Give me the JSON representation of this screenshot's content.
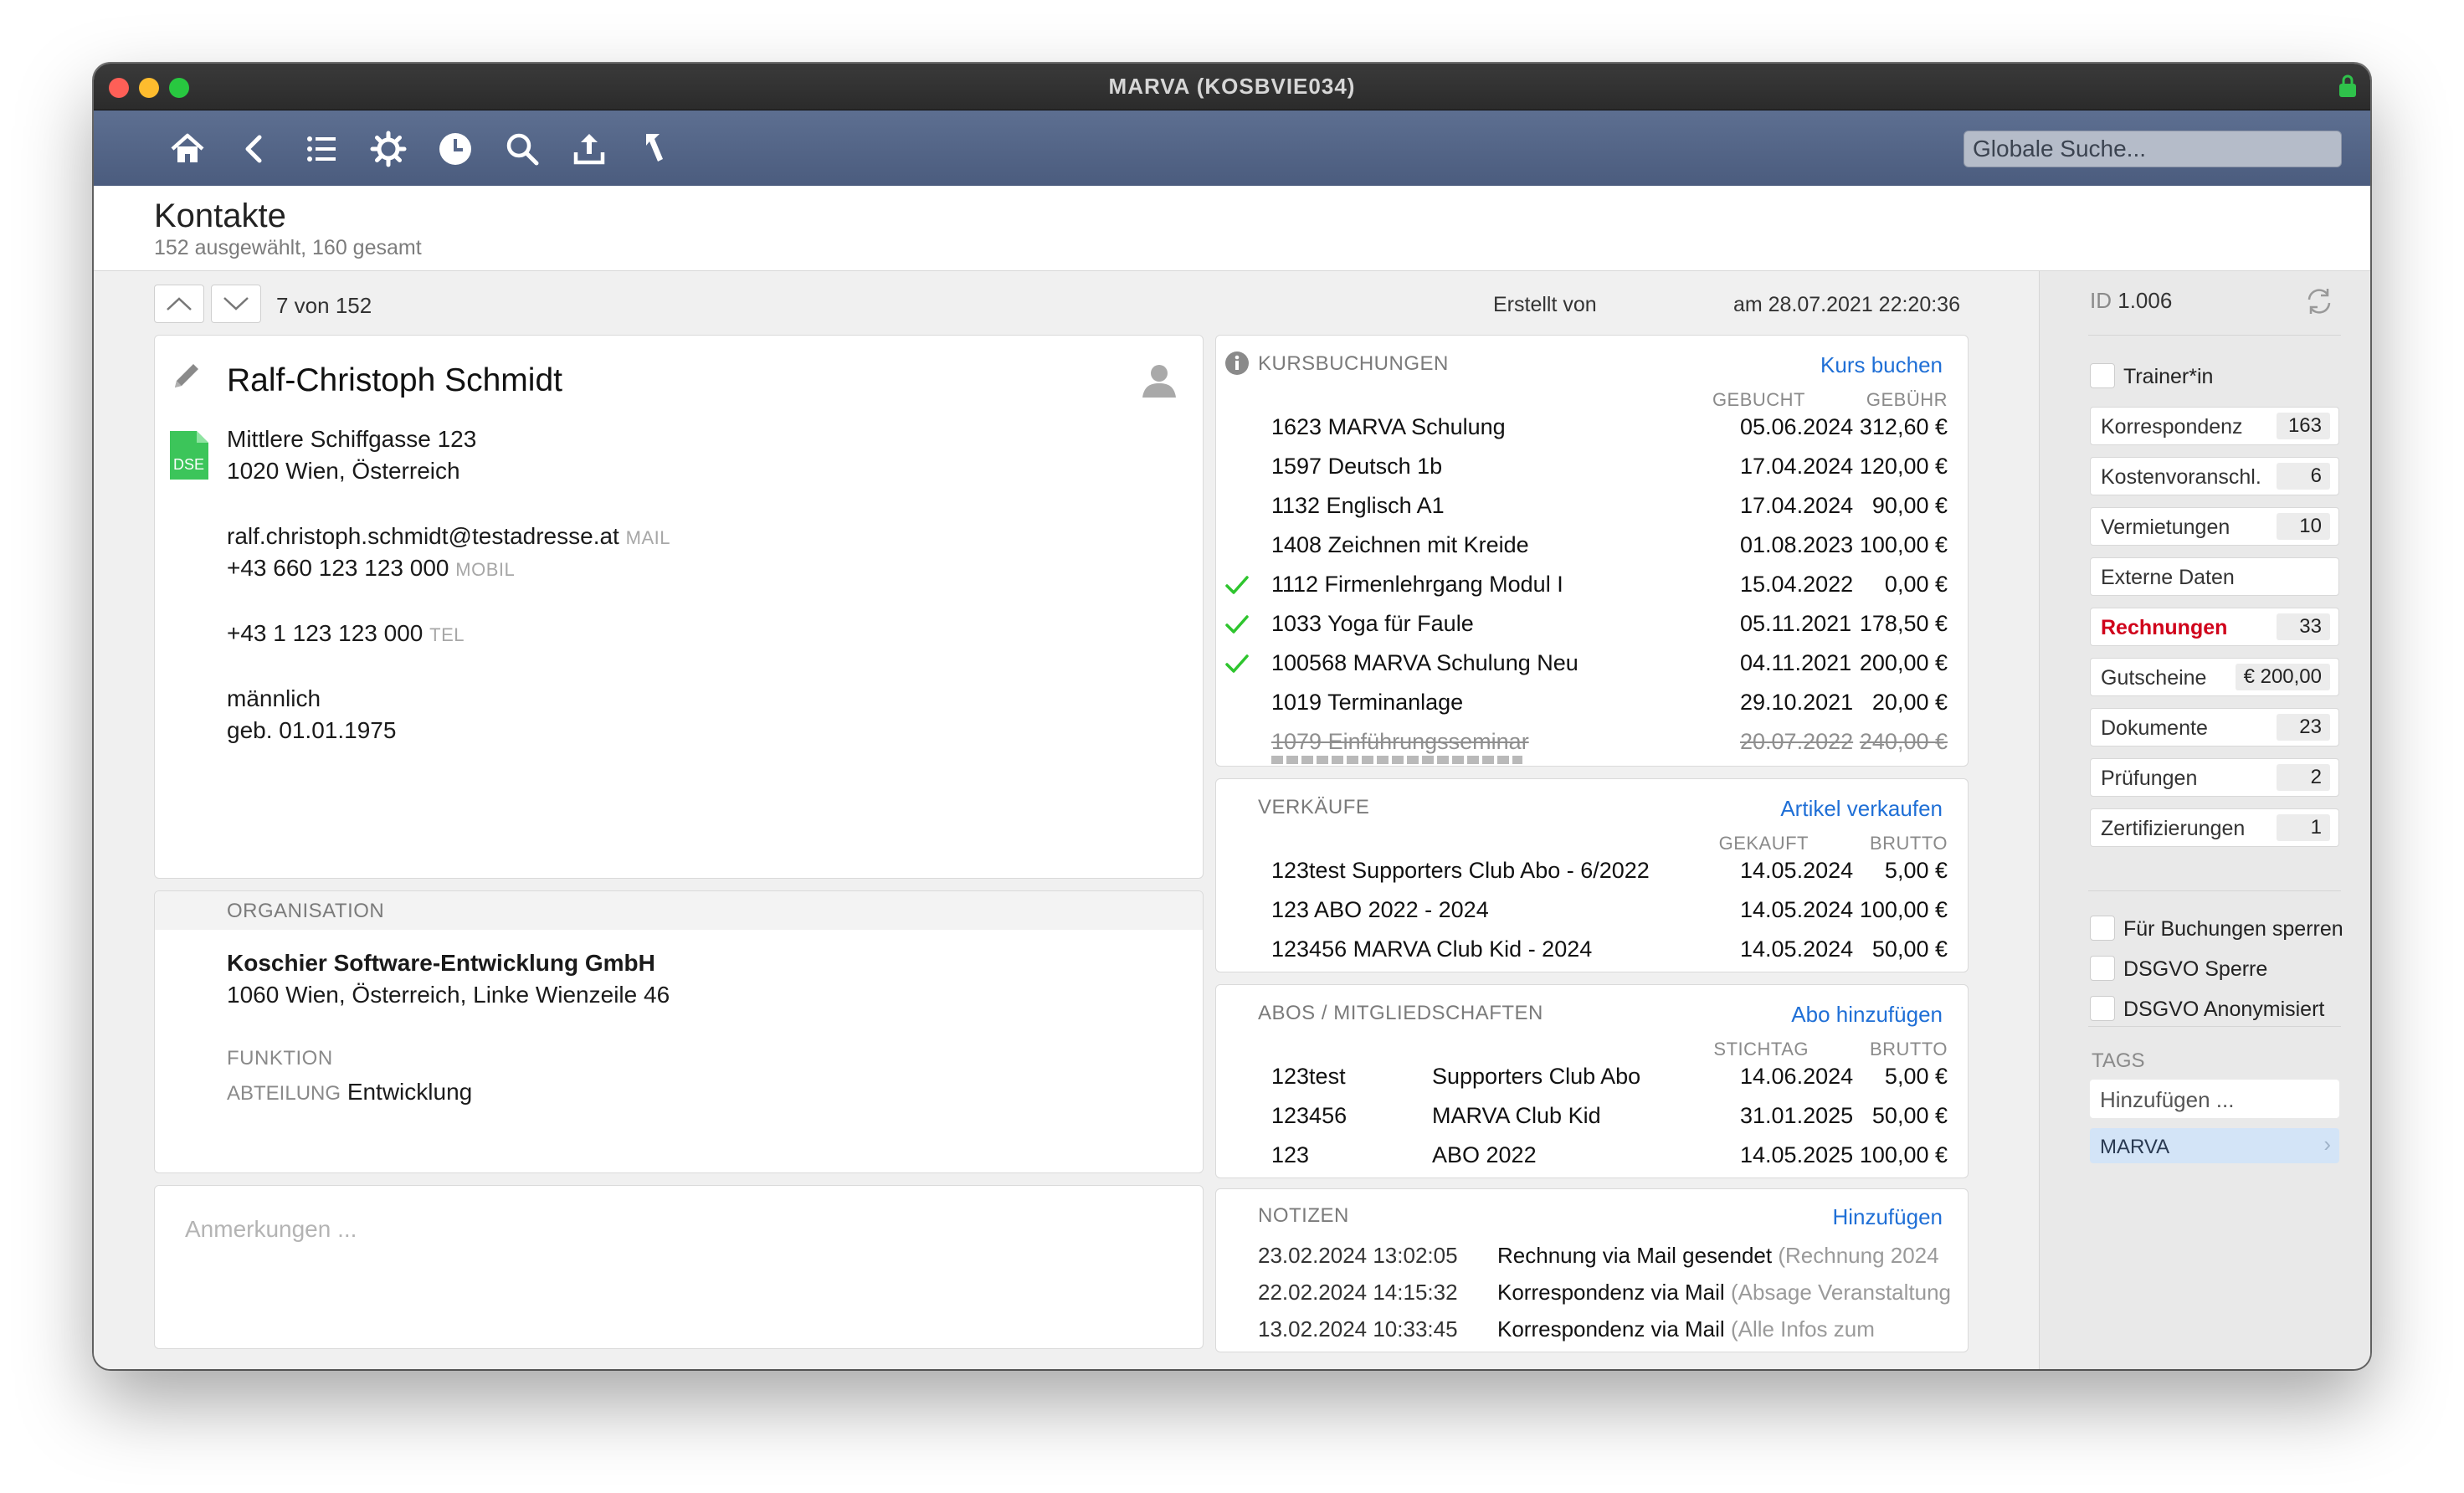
{
  "window": {
    "title": "MARVA (KOSBVIE034)"
  },
  "toolbar": {
    "search_placeholder": "Globale Suche..."
  },
  "header": {
    "title": "Kontakte",
    "subtitle": "152 ausgewählt, 160 gesamt"
  },
  "nav": {
    "position": "7 von 152",
    "created_by_label": "Erstellt von",
    "created_at": "am 28.07.2021 22:20:36"
  },
  "contact": {
    "name": "Ralf-Christoph Schmidt",
    "dse_badge": "DSE",
    "street": "Mittlere Schiffgasse 123",
    "city": "1020 Wien, Österreich",
    "email": "ralf.christoph.schmidt@testadresse.at",
    "email_tag": "MAIL",
    "mobile": "+43 660 123 123 000",
    "mobile_tag": "MOBIL",
    "phone": "+43 1 123 123 000",
    "phone_tag": "TEL",
    "gender": "männlich",
    "birth": "geb. 01.01.1975"
  },
  "organisation": {
    "header": "ORGANISATION",
    "name": "Koschier Software-Entwicklung GmbH",
    "address": "1060 Wien, Österreich, Linke Wienzeile 46",
    "funktion_label": "FUNKTION",
    "abteilung_label": "ABTEILUNG",
    "abteilung": "Entwicklung"
  },
  "notes": {
    "placeholder": "Anmerkungen ..."
  },
  "kursbuchungen": {
    "header": "KURSBUCHUNGEN",
    "action": "Kurs buchen",
    "col_booked": "GEBUCHT",
    "col_fee": "GEBÜHR",
    "rows": [
      {
        "course": "1623 MARVA Schulung",
        "date": "05.06.2024",
        "fee": "312,60 €",
        "check": false,
        "cancelled": false
      },
      {
        "course": "1597 Deutsch 1b",
        "date": "17.04.2024",
        "fee": "120,00 €",
        "check": false,
        "cancelled": false
      },
      {
        "course": "1132 Englisch A1",
        "date": "17.04.2024",
        "fee": "90,00 €",
        "check": false,
        "cancelled": false
      },
      {
        "course": "1408 Zeichnen mit Kreide",
        "date": "01.08.2023",
        "fee": "100,00 €",
        "check": false,
        "cancelled": false
      },
      {
        "course": "1112 Firmenlehrgang Modul I",
        "date": "15.04.2022",
        "fee": "0,00 €",
        "check": true,
        "cancelled": false
      },
      {
        "course": "1033 Yoga für Faule",
        "date": "05.11.2021",
        "fee": "178,50 €",
        "check": true,
        "cancelled": false
      },
      {
        "course": "100568 MARVA Schulung Neu",
        "date": "04.11.2021",
        "fee": "200,00 €",
        "check": true,
        "cancelled": false
      },
      {
        "course": "1019 Terminanlage",
        "date": "29.10.2021",
        "fee": "20,00 €",
        "check": false,
        "cancelled": false
      },
      {
        "course": "1079 Einführungsseminar",
        "date": "20.07.2022",
        "fee": "240,00 €",
        "check": false,
        "cancelled": true
      }
    ]
  },
  "verkaeufe": {
    "header": "VERKÄUFE",
    "action": "Artikel verkaufen",
    "col_bought": "GEKAUFT",
    "col_gross": "BRUTTO",
    "rows": [
      {
        "item": "123test Supporters Club Abo - 6/2022",
        "date": "14.05.2024",
        "gross": "5,00 €"
      },
      {
        "item": "123 ABO 2022 - 2024",
        "date": "14.05.2024",
        "gross": "100,00 €"
      },
      {
        "item": "123456 MARVA Club Kid - 2024",
        "date": "14.05.2024",
        "gross": "50,00 €"
      }
    ]
  },
  "abos": {
    "header": "ABOS / MITGLIEDSCHAFTEN",
    "action": "Abo hinzufügen",
    "col_date": "STICHTAG",
    "col_gross": "BRUTTO",
    "rows": [
      {
        "nr": "123test",
        "name": "Supporters Club Abo",
        "date": "14.06.2024",
        "gross": "5,00 €"
      },
      {
        "nr": "123456",
        "name": "MARVA Club Kid",
        "date": "31.01.2025",
        "gross": "50,00 €"
      },
      {
        "nr": "123",
        "name": "ABO 2022",
        "date": "14.05.2025",
        "gross": "100,00 €"
      }
    ]
  },
  "notizen": {
    "header": "NOTIZEN",
    "action": "Hinzufügen",
    "rows": [
      {
        "time": "23.02.2024 13:02:05",
        "text": "Rechnung via Mail gesendet",
        "detail": "(Rechnung 2024"
      },
      {
        "time": "22.02.2024 14:15:32",
        "text": "Korrespondenz via Mail",
        "detail": "(Absage Veranstaltung"
      },
      {
        "time": "13.02.2024 10:33:45",
        "text": "Korrespondenz via Mail",
        "detail": "(Alle Infos zum"
      }
    ]
  },
  "sidebar": {
    "id_label": "ID",
    "id_value": "1.006",
    "trainer_label": "Trainer*in",
    "items": [
      {
        "label": "Korrespondenz",
        "count": "163",
        "highlight": false
      },
      {
        "label": "Kostenvoranschl.",
        "count": "6",
        "highlight": false
      },
      {
        "label": "Vermietungen",
        "count": "10",
        "highlight": false
      },
      {
        "label": "Externe Daten",
        "count": "",
        "highlight": false
      },
      {
        "label": "Rechnungen",
        "count": "33",
        "highlight": true
      },
      {
        "label": "Gutscheine",
        "count": "€ 200,00",
        "highlight": false
      },
      {
        "label": "Dokumente",
        "count": "23",
        "highlight": false
      },
      {
        "label": "Prüfungen",
        "count": "2",
        "highlight": false
      },
      {
        "label": "Zertifizierungen",
        "count": "1",
        "highlight": false
      }
    ],
    "flags": [
      "Für Buchungen sperren",
      "DSGVO Sperre",
      "DSGVO Anonymisiert"
    ],
    "tags_header": "TAGS",
    "tags_add": "Hinzufügen ...",
    "tag": "MARVA"
  },
  "colors": {
    "accent_link": "#1f6fd6",
    "highlight_red": "#d0021b",
    "check_green": "#2ec52e",
    "toolbar": "#56678a",
    "tag_bg": "#d3e4f7"
  }
}
